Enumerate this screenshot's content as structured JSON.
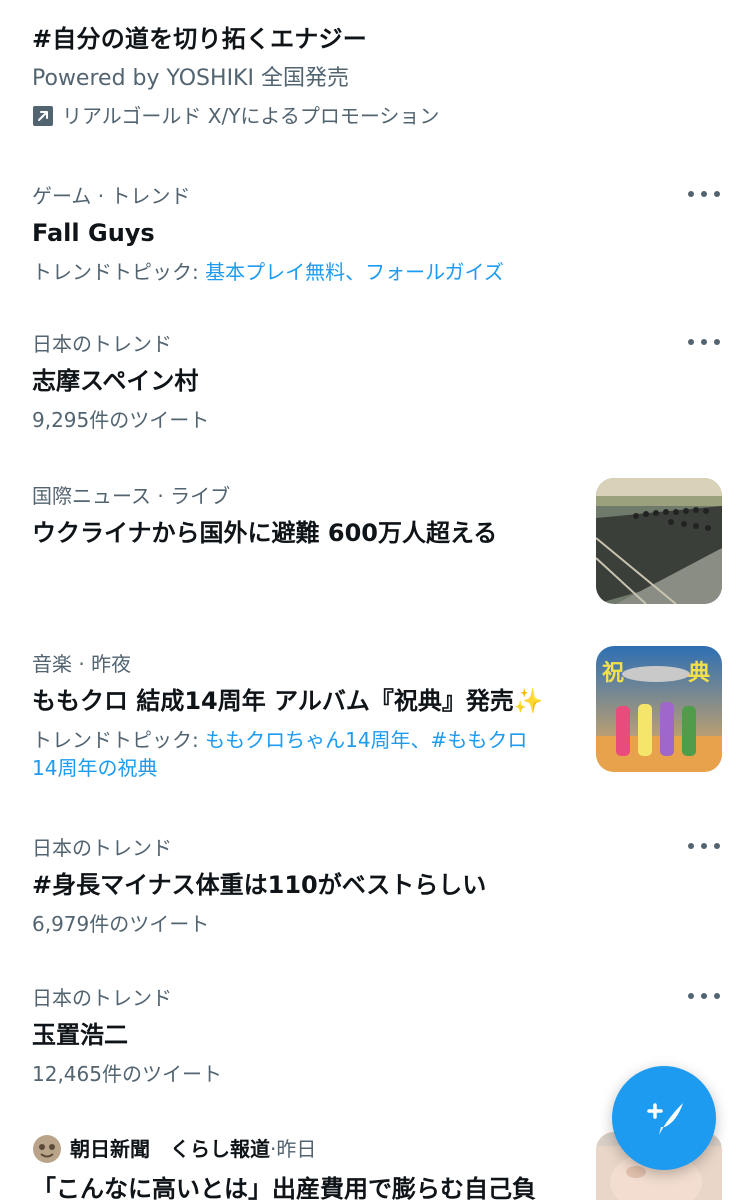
{
  "promo": {
    "title": "#自分の道を切り拓くエナジー",
    "subtitle": "Powered by YOSHIKI 全国発売",
    "promoted_by": "リアルゴールド X/Yによるプロモーション",
    "icon": "promoted-arrow-icon"
  },
  "trends": [
    {
      "meta": "ゲーム · トレンド",
      "title": "Fall Guys",
      "sub_prefix": "トレンドトピック: ",
      "sub_links": "基本プレイ無料、フォールガイズ"
    },
    {
      "meta": "日本のトレンド",
      "title": "志摩スペイン村",
      "sub": "9,295件のツイート"
    },
    {
      "meta": "国際ニュース · ライブ",
      "title": "ウクライナから国外に避難 600万人超える"
    },
    {
      "meta": "音楽 · 昨夜",
      "title_line": "ももクロ 結成14周年 アルバム『祝典』発売✨",
      "sub_prefix": "トレンドトピック: ",
      "sub_links_line1": "ももクロちゃん14周年、#ももクロ",
      "sub_links_line2": "14周年の祝典"
    },
    {
      "meta": "日本のトレンド",
      "title": "#身長マイナス体重は110がベストらしい",
      "sub": "6,979件のツイート"
    },
    {
      "meta": "日本のトレンド",
      "title": "玉置浩二",
      "sub": "12,465件のツイート"
    }
  ],
  "news": {
    "source": "朝日新聞　くらし報道",
    "separator": " · ",
    "time": "昨日",
    "title": "「こんなに高いとは」出産費用で膨らむ自己負"
  },
  "fab": {
    "icon": "compose-tweet-icon"
  },
  "colors": {
    "accent": "#1d9bf0",
    "text": "#0f1419",
    "secondary": "#536471"
  }
}
